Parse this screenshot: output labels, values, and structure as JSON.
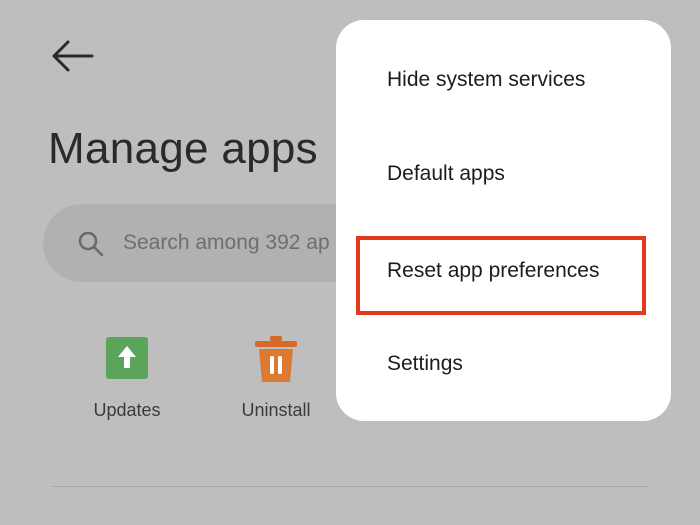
{
  "header": {
    "title": "Manage apps",
    "back_icon": "arrow-left-icon"
  },
  "search": {
    "placeholder": "Search among 392 ap",
    "icon": "search-icon"
  },
  "actions": [
    {
      "label": "Updates",
      "icon": "update-arrow-icon",
      "color": "#5cb85c"
    },
    {
      "label": "Uninstall",
      "icon": "trash-icon",
      "color": "#e07a33"
    }
  ],
  "menu": {
    "items": [
      {
        "label": "Hide system services"
      },
      {
        "label": "Default apps"
      },
      {
        "label": "Reset app preferences",
        "highlighted": true
      },
      {
        "label": "Settings"
      }
    ],
    "highlight_color": "#e2391f"
  }
}
